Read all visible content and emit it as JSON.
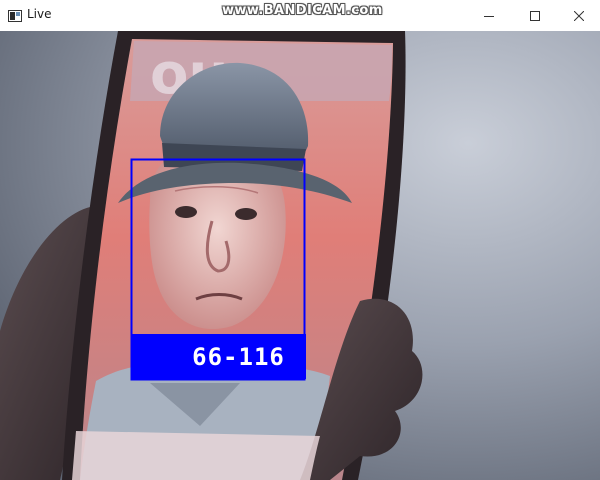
{
  "window": {
    "title": "Live",
    "icon": "camera-feed-icon",
    "controls": [
      "minimize-icon",
      "maximize-icon",
      "close-icon"
    ]
  },
  "overlay": {
    "watermark": "www.BANDICAM.com"
  },
  "detection": {
    "label": "66-116",
    "box_color": "#0000ff",
    "label_color": "#ffffff"
  }
}
